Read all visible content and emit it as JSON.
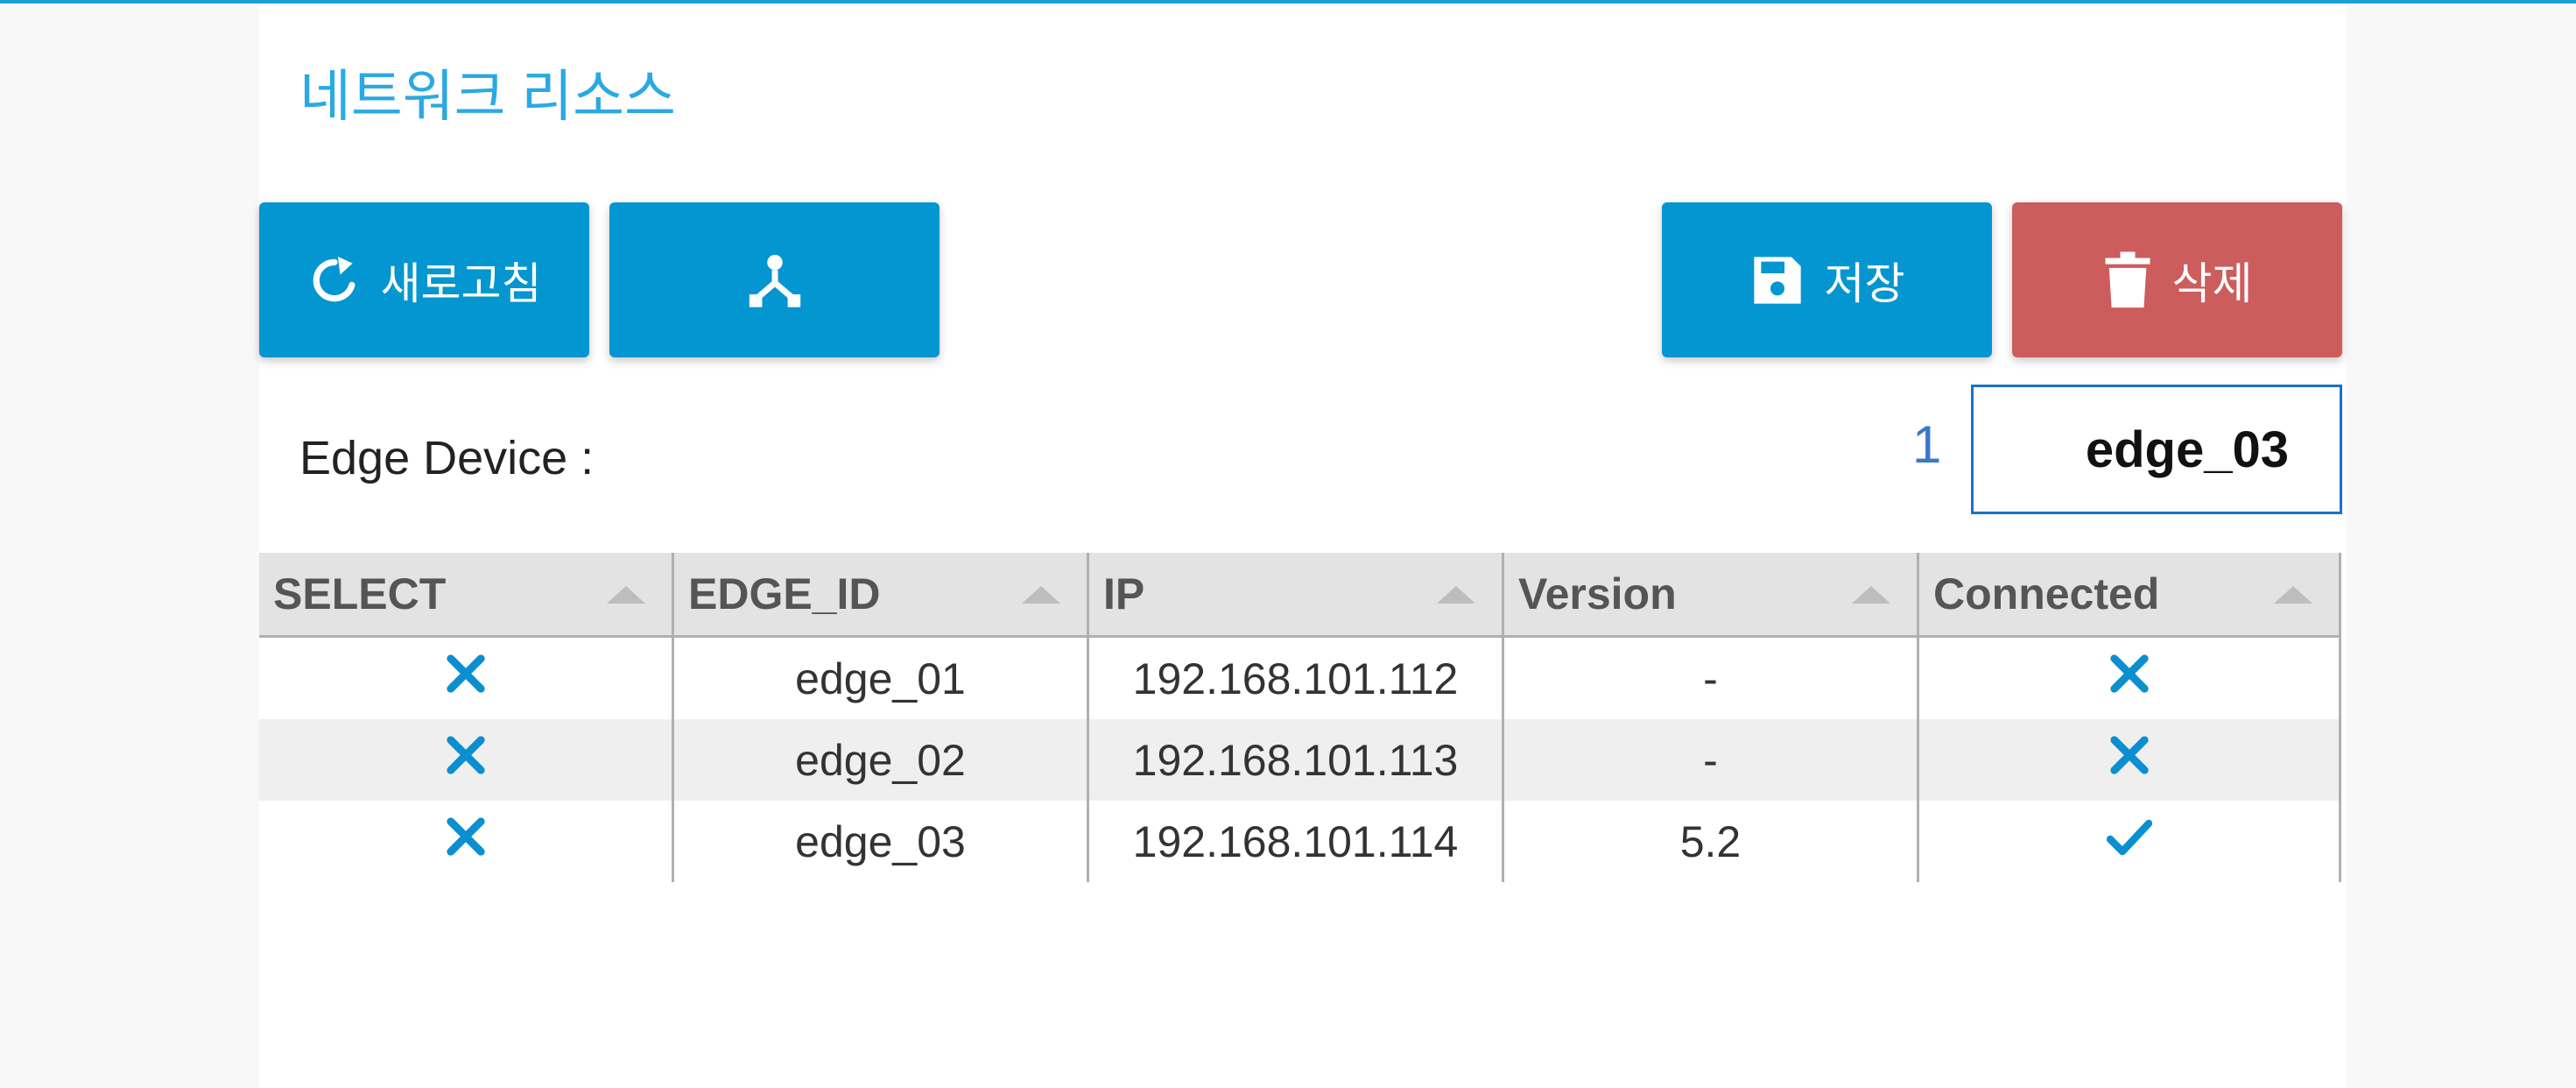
{
  "page": {
    "title": "네트워크 리소스"
  },
  "toolbar": {
    "refresh_label": "새로고침",
    "save_label": "저장",
    "delete_label": "삭제"
  },
  "edge_device": {
    "label": "Edge Device :",
    "count": "1",
    "selected": "edge_03"
  },
  "table": {
    "columns": [
      "SELECT",
      "EDGE_ID",
      "IP",
      "Version",
      "Connected"
    ],
    "rows": [
      {
        "select": false,
        "edge_id": "edge_01",
        "ip": "192.168.101.112",
        "version": "-",
        "connected": false
      },
      {
        "select": false,
        "edge_id": "edge_02",
        "ip": "192.168.101.113",
        "version": "-",
        "connected": false
      },
      {
        "select": false,
        "edge_id": "edge_03",
        "ip": "192.168.101.114",
        "version": "5.2",
        "connected": true
      }
    ]
  },
  "colors": {
    "accent": "#0496d0",
    "danger": "#cd5c5c",
    "title": "#2aa9e2",
    "icon_true_false": "#0a8fd0"
  },
  "icons": {
    "refresh": "refresh-icon",
    "topology": "topology-icon",
    "save": "floppy-disk-icon",
    "delete": "trash-icon",
    "false": "close-icon",
    "true": "check-icon"
  }
}
